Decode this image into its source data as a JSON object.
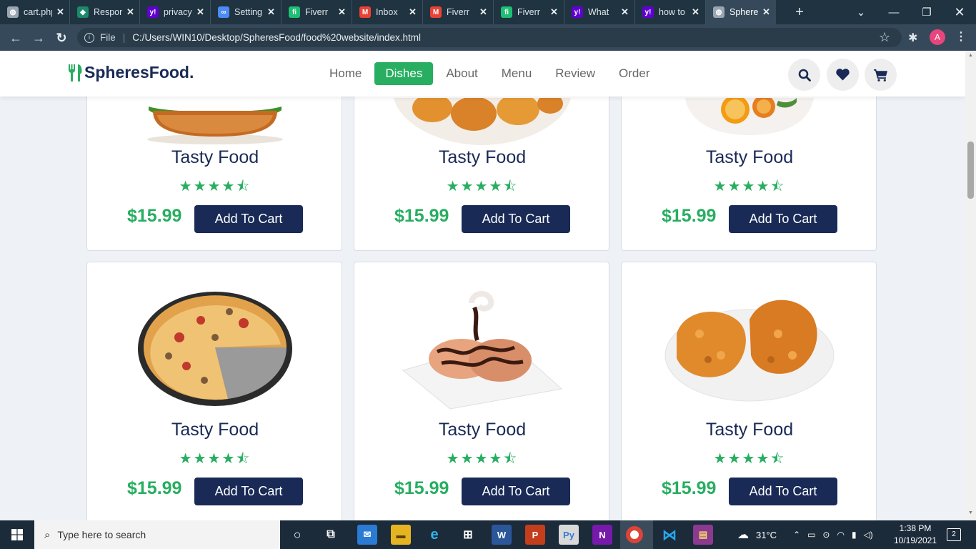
{
  "browser": {
    "tabs": [
      {
        "label": "cart.php",
        "icon": "globe-icon",
        "color": "#9aa7b2"
      },
      {
        "label": "Respon",
        "icon": "drop-icon",
        "color": "#1a8a6a"
      },
      {
        "label": "privacy",
        "icon": "yahoo-icon",
        "color": "#6001d2"
      },
      {
        "label": "Setting",
        "icon": "loop-icon",
        "color": "#4c8bf5"
      },
      {
        "label": "Fiverr",
        "icon": "fiverr-icon",
        "color": "#1dbf73"
      },
      {
        "label": "Inbox",
        "icon": "gmail-icon",
        "color": "#ea4335"
      },
      {
        "label": "Fiverr",
        "icon": "gmail-icon",
        "color": "#ea4335"
      },
      {
        "label": "Fiverr",
        "icon": "fiverr-icon",
        "color": "#1dbf73"
      },
      {
        "label": "What",
        "icon": "yahoo-icon",
        "color": "#6001d2"
      },
      {
        "label": "how to",
        "icon": "yahoo-icon",
        "color": "#6001d2"
      },
      {
        "label": "Sphere",
        "icon": "globe-icon",
        "color": "#9aa7b2"
      }
    ],
    "address_prefix": "File",
    "url": "C:/Users/WIN10/Desktop/SpheresFood/food%20website/index.html",
    "profile_initial": "A"
  },
  "site": {
    "logo": "SpheresFood.",
    "nav": [
      "Home",
      "Dishes",
      "About",
      "Menu",
      "Review",
      "Order"
    ],
    "active_nav": "Dishes",
    "accent_color": "#27ae60",
    "dark_color": "#192a56"
  },
  "dishes": [
    {
      "title": "Tasty Food",
      "rating": 4.5,
      "price": "$15.99",
      "button": "Add To Cart",
      "image": "burger"
    },
    {
      "title": "Tasty Food",
      "rating": 4.5,
      "price": "$15.99",
      "button": "Add To Cart",
      "image": "nuggets"
    },
    {
      "title": "Tasty Food",
      "rating": 4.5,
      "price": "$15.99",
      "button": "Add To Cart",
      "image": "orange-plate"
    },
    {
      "title": "Tasty Food",
      "rating": 4.5,
      "price": "$15.99",
      "button": "Add To Cart",
      "image": "pizza"
    },
    {
      "title": "Tasty Food",
      "rating": 4.5,
      "price": "$15.99",
      "button": "Add To Cart",
      "image": "dessert"
    },
    {
      "title": "Tasty Food",
      "rating": 4.5,
      "price": "$15.99",
      "button": "Add To Cart",
      "image": "fried-chicken"
    }
  ],
  "taskbar": {
    "search_placeholder": "Type here to search",
    "temperature": "31°C",
    "time": "1:38 PM",
    "date": "10/19/2021",
    "notifications": "2"
  }
}
